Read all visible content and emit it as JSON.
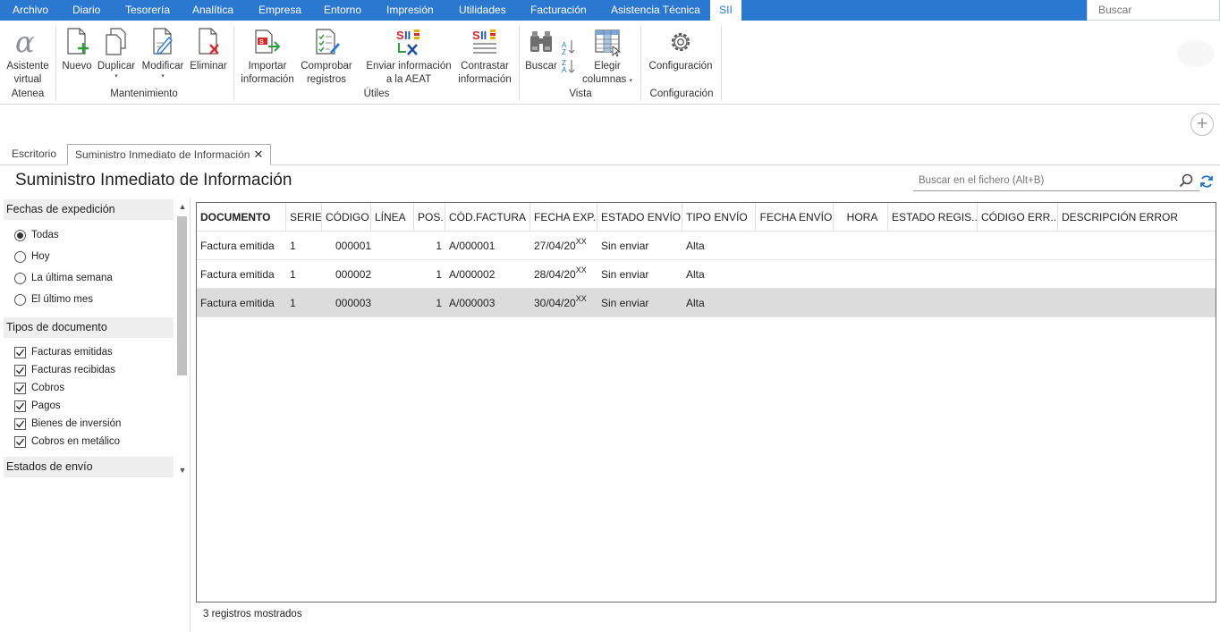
{
  "menu": {
    "items": [
      "Archivo",
      "Diario",
      "Tesorería",
      "Analítica",
      "Empresa",
      "Entorno",
      "Impresión",
      "Utilidades",
      "Facturación",
      "Asistencia Técnica",
      "SII"
    ],
    "active_index": 10,
    "search_placeholder": "Buscar"
  },
  "ribbon": {
    "buttons": {
      "asistente": [
        "Asistente",
        "virtual"
      ],
      "nuevo": [
        "Nuevo"
      ],
      "duplicar": [
        "Duplicar"
      ],
      "modificar": [
        "Modificar"
      ],
      "eliminar": [
        "Eliminar"
      ],
      "importar": [
        "Importar",
        "información"
      ],
      "comprobar": [
        "Comprobar",
        "registros"
      ],
      "enviar": [
        "Enviar información",
        "a la AEAT"
      ],
      "contrastar": [
        "Contrastar",
        "información"
      ],
      "buscar": [
        "Buscar"
      ],
      "elegir": [
        "Elegir",
        "columnas"
      ],
      "configuracion": [
        "Configuración"
      ]
    },
    "groups": {
      "atenea": "Atenea",
      "mantenimiento": "Mantenimiento",
      "utiles": "Útiles",
      "vista": "Vista",
      "configuracion": "Configuración"
    },
    "dropdown_arrow": "▾"
  },
  "tabs": [
    {
      "label": "Escritorio",
      "active": false
    },
    {
      "label": "Suministro Inmediato de Información",
      "active": true
    }
  ],
  "page": {
    "title": "Suministro Inmediato de Información",
    "search_placeholder": "Buscar en el fichero (Alt+B)"
  },
  "filters": {
    "fechas": {
      "title": "Fechas de expedición",
      "options": [
        "Todas",
        "Hoy",
        "La última semana",
        "El último mes"
      ],
      "selected": 0
    },
    "tipos": {
      "title": "Tipos de documento",
      "options": [
        "Facturas emitidas",
        "Facturas recibidas",
        "Cobros",
        "Pagos",
        "Bienes de inversión",
        "Cobros en metálico"
      ],
      "checked": [
        true,
        true,
        true,
        true,
        true,
        true
      ]
    },
    "estados": {
      "title": "Estados de envío"
    }
  },
  "grid": {
    "columns": [
      "DOCUMENTO",
      "SERIE",
      "CÓDIGO",
      "LÍNEA",
      "POS.",
      "CÓD.FACTURA",
      "FECHA EXP.",
      "ESTADO ENVÍO",
      "TIPO ENVÍO",
      "FECHA ENVÍO",
      "HORA",
      "ESTADO REGIS...",
      "CÓDIGO ERR...",
      "DESCRIPCIÓN ERROR"
    ],
    "rows": [
      {
        "documento": "Factura emitida",
        "serie": "1",
        "codigo": "000001",
        "linea": "",
        "pos": "1",
        "cod_factura": "A/000001",
        "fecha_exp": "27/04/20",
        "fecha_sup": "XX",
        "estado_envio": "Sin enviar",
        "tipo_envio": "Alta"
      },
      {
        "documento": "Factura emitida",
        "serie": "1",
        "codigo": "000002",
        "linea": "",
        "pos": "1",
        "cod_factura": "A/000002",
        "fecha_exp": "28/04/20",
        "fecha_sup": "XX",
        "estado_envio": "Sin enviar",
        "tipo_envio": "Alta"
      },
      {
        "documento": "Factura emitida",
        "serie": "1",
        "codigo": "000003",
        "linea": "",
        "pos": "1",
        "cod_factura": "A/000003",
        "fecha_exp": "30/04/20",
        "fecha_sup": "XX",
        "estado_envio": "Sin enviar",
        "tipo_envio": "Alta"
      }
    ],
    "selected_row": 2,
    "footer": "3 registros mostrados"
  },
  "colors": {
    "menu_bg": "#2b78d0",
    "selected_row": "#dcdcdc",
    "accent_blue": "#1e73be"
  }
}
